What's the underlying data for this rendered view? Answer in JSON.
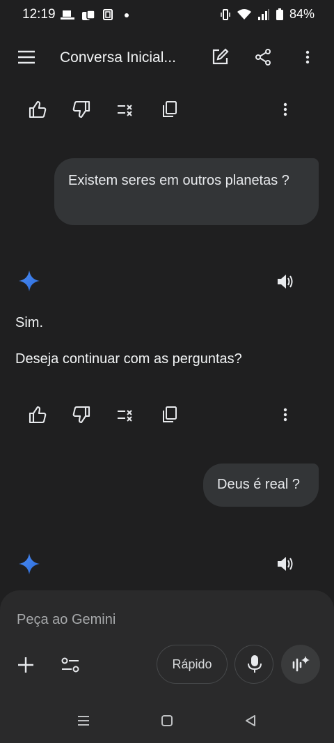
{
  "status_bar": {
    "time": "12:19",
    "battery": "84%"
  },
  "header": {
    "title": "Conversa Inicial..."
  },
  "conversation": {
    "msg1": {
      "user": "Existem seres em outros planetas ?"
    },
    "resp1": {
      "line1": "Sim.",
      "line2": "Deseja continuar com as perguntas?"
    },
    "msg2": {
      "user": "Deus é real ?"
    }
  },
  "composer": {
    "placeholder": "Peça ao Gemini",
    "mode_label": "Rápido"
  },
  "colors": {
    "background": "#1f1f20",
    "bubble": "#333537",
    "accent": "#4c8df6"
  }
}
